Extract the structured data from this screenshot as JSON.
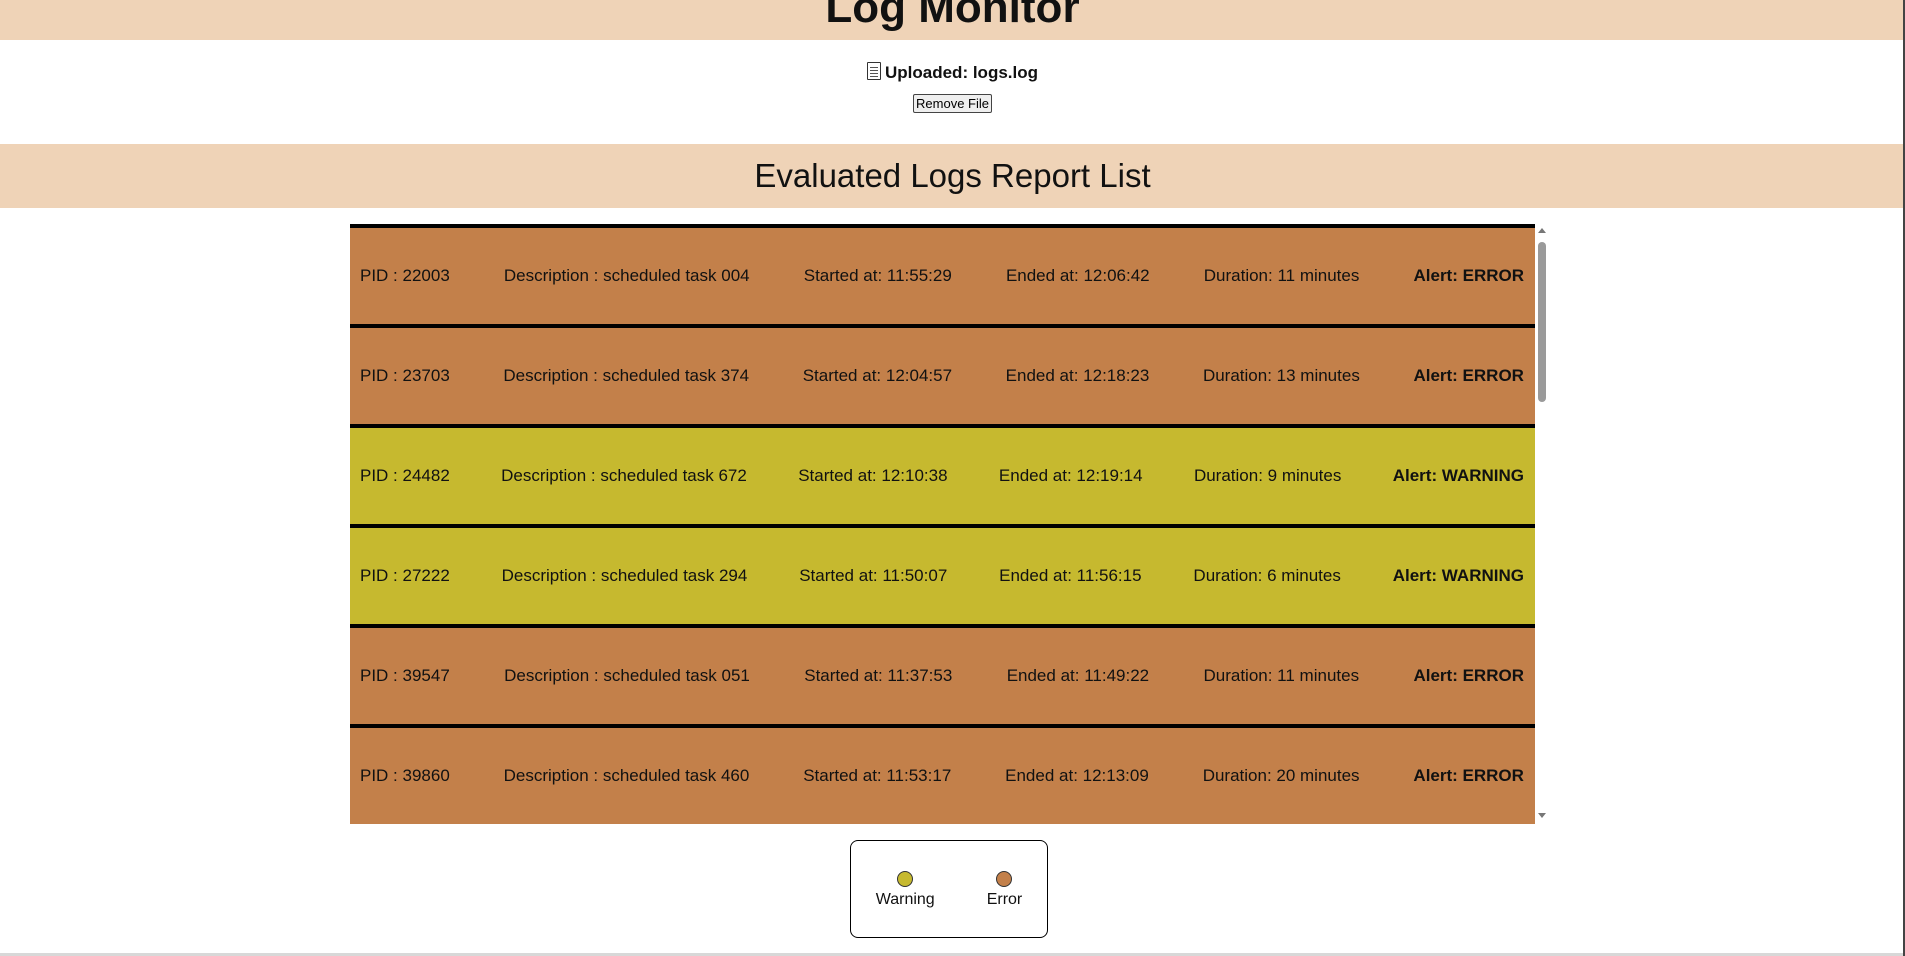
{
  "header": {
    "title": "Log Monitor"
  },
  "upload": {
    "icon": "document-icon",
    "label": "Uploaded: logs.log",
    "remove_label": "Remove File"
  },
  "section": {
    "title": "Evaluated Logs Report List"
  },
  "colors": {
    "header_bg": "#efd3b7",
    "error": "#c3804a",
    "warning": "#c6b92f"
  },
  "logs": [
    {
      "pid": "PID : 22003",
      "description": "Description : scheduled task 004",
      "started": "Started at: 11:55:29",
      "ended": "Ended at: 12:06:42",
      "duration": "Duration: 11 minutes",
      "alert": "Alert: ERROR",
      "level": "error"
    },
    {
      "pid": "PID : 23703",
      "description": "Description : scheduled task 374",
      "started": "Started at: 12:04:57",
      "ended": "Ended at: 12:18:23",
      "duration": "Duration: 13 minutes",
      "alert": "Alert: ERROR",
      "level": "error"
    },
    {
      "pid": "PID : 24482",
      "description": "Description : scheduled task 672",
      "started": "Started at: 12:10:38",
      "ended": "Ended at: 12:19:14",
      "duration": "Duration: 9 minutes",
      "alert": "Alert: WARNING",
      "level": "warning"
    },
    {
      "pid": "PID : 27222",
      "description": "Description : scheduled task 294",
      "started": "Started at: 11:50:07",
      "ended": "Ended at: 11:56:15",
      "duration": "Duration: 6 minutes",
      "alert": "Alert: WARNING",
      "level": "warning"
    },
    {
      "pid": "PID : 39547",
      "description": "Description : scheduled task 051",
      "started": "Started at: 11:37:53",
      "ended": "Ended at: 11:49:22",
      "duration": "Duration: 11 minutes",
      "alert": "Alert: ERROR",
      "level": "error"
    },
    {
      "pid": "PID : 39860",
      "description": "Description : scheduled task 460",
      "started": "Started at: 11:53:17",
      "ended": "Ended at: 12:13:09",
      "duration": "Duration: 20 minutes",
      "alert": "Alert: ERROR",
      "level": "error"
    }
  ],
  "legend": {
    "items": [
      {
        "label": "Warning",
        "color": "#c6b92f"
      },
      {
        "label": "Error",
        "color": "#c3804a"
      }
    ]
  }
}
